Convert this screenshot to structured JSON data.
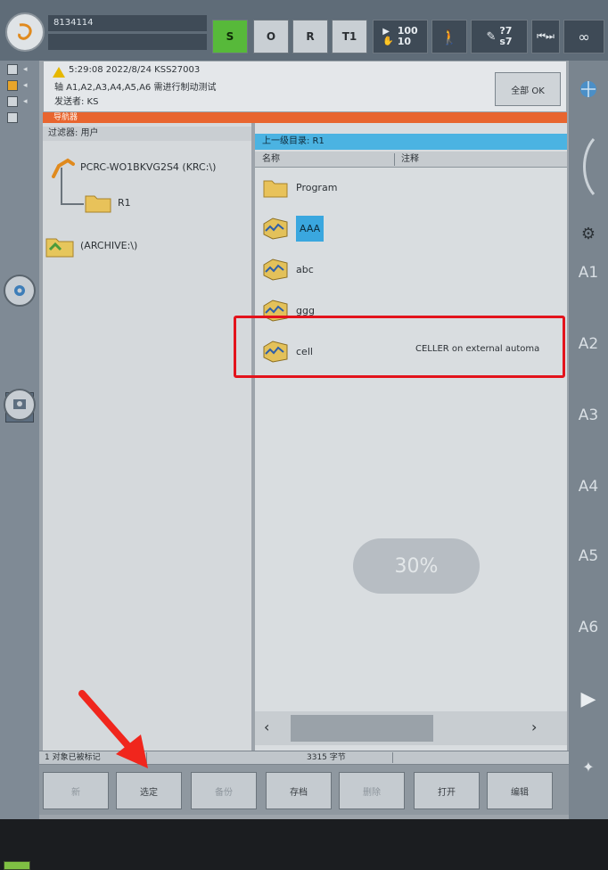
{
  "topbar": {
    "robot_name": "8134114",
    "status_s": "S",
    "status_o": "O",
    "status_r": "R",
    "mode": "T1",
    "override_run": "100",
    "override_jog": "10",
    "tool_top": "?7",
    "tool_bottom": "s7",
    "infinity": "∞"
  },
  "message": {
    "line1": "5:29:08 2022/8/24 KSS27003",
    "line2": "轴 A1,A2,A3,A4,A5,A6 需进行制动测试",
    "line3": "发送者: KS",
    "ok_label": "全部 OK"
  },
  "navigator_label": "导航器",
  "filter_label": "过滤器: 用户",
  "tree": {
    "root": "PCRC-WO1BKVG2S4 (KRC:\\)",
    "child": "R1",
    "archive": "(ARCHIVE:\\)"
  },
  "right_pane": {
    "title": "上一级目录: R1",
    "col_name": "名称",
    "col_comment": "注释",
    "files": [
      {
        "name": "Program"
      },
      {
        "name": "AAA"
      },
      {
        "name": "abc"
      },
      {
        "name": "ggg"
      },
      {
        "name": "cell"
      }
    ],
    "cell_comment": "CELLER on external automa"
  },
  "progress": "30%",
  "status": {
    "left": "1 对象已被标记",
    "mid": "3315 字节"
  },
  "softkeys": [
    "新",
    "选定",
    "备份",
    "存档",
    "删除",
    "打开",
    "编辑"
  ],
  "axes": [
    "A1",
    "A2",
    "A3",
    "A4",
    "A5",
    "A6"
  ],
  "colors": {
    "accent_blue": "#3aa7df",
    "nav_orange": "#e8652f",
    "highlight_red": "#e3131c",
    "status_green": "#57b93a"
  }
}
